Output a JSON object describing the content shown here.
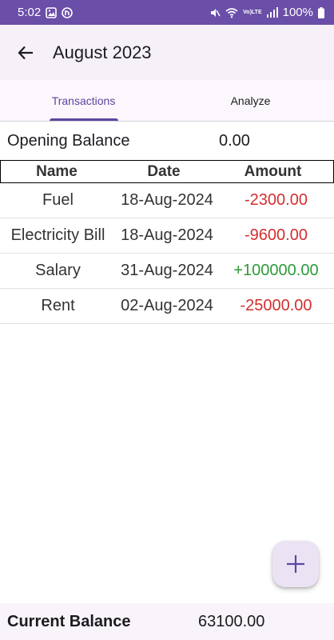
{
  "status_bar": {
    "time": "5:02",
    "battery": "100%",
    "lte_label_top": "Vo)",
    "lte_label_bottom": "LTE"
  },
  "app_bar": {
    "title": "August 2023",
    "back_icon": "arrow-back-icon"
  },
  "tabs": [
    {
      "label": "Transactions",
      "active": true
    },
    {
      "label": "Analyze",
      "active": false
    }
  ],
  "opening_balance": {
    "label": "Opening Balance",
    "value": "0.00"
  },
  "table": {
    "headers": {
      "name": "Name",
      "date": "Date",
      "amount": "Amount"
    },
    "rows": [
      {
        "name": "Fuel",
        "date": "18-Aug-2024",
        "amount": "-2300.00",
        "type": "debit"
      },
      {
        "name": "Electricity Bill",
        "date": "18-Aug-2024",
        "amount": "-9600.00",
        "type": "debit"
      },
      {
        "name": "Salary",
        "date": "31-Aug-2024",
        "amount": "+100000.00",
        "type": "credit"
      },
      {
        "name": "Rent",
        "date": "02-Aug-2024",
        "amount": "-25000.00",
        "type": "debit"
      }
    ]
  },
  "fab": {
    "icon": "plus-icon"
  },
  "current_balance": {
    "label": "Current Balance",
    "value": "63100.00"
  },
  "colors": {
    "status_bar": "#6a4ea8",
    "accent": "#5b46a0",
    "debit": "#d32f2f",
    "credit": "#2e9a3a"
  }
}
